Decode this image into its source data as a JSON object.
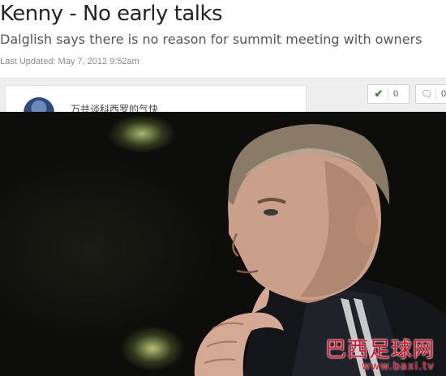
{
  "article": {
    "headline": "Kenny - No early talks",
    "standfirst": "Dalglish says there is no reason for summit meeting with owners",
    "last_updated": "Last Updated: May 7, 2012 9:52am"
  },
  "toolbar": {
    "author_text": "(Chinese text partially visible, illegible)",
    "like_count": "0",
    "comment_count": "0",
    "like_icon": "check-icon",
    "comment_icon": "speech-bubble-icon"
  },
  "photo": {
    "description_icon": "portrait-photo",
    "watermark_cn": "巴西足球网",
    "watermark_url": "www.baxi.tv"
  },
  "colors": {
    "watermark": "#e0102a",
    "headline": "#232323",
    "standfirst": "#555555"
  }
}
